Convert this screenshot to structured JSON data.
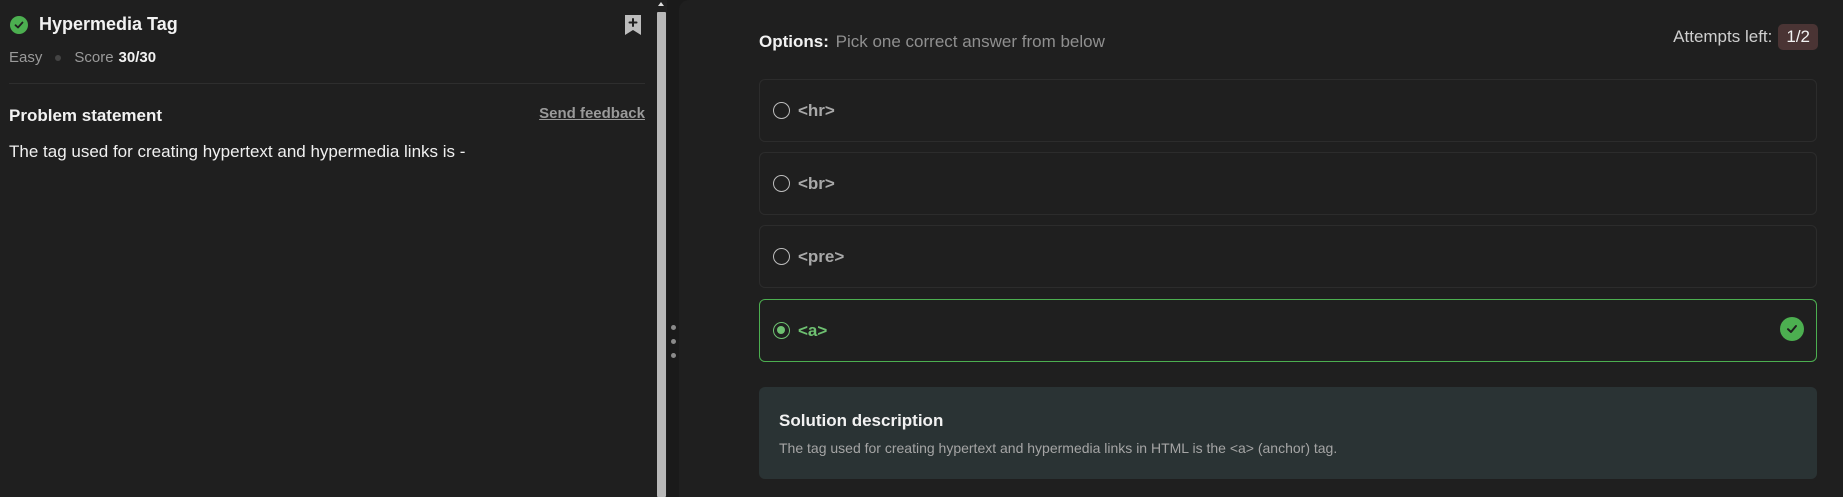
{
  "problem": {
    "title": "Hypermedia Tag",
    "difficulty": "Easy",
    "score_label": "Score",
    "score_value": "30/30",
    "statement_heading": "Problem statement",
    "feedback_link": "Send feedback",
    "statement": "The tag used for creating hypertext and hypermedia links is -"
  },
  "options_panel": {
    "label": "Options:",
    "instruction": "Pick one correct answer from below",
    "attempts_label": "Attempts left:",
    "attempts_value": "1/2",
    "options": [
      {
        "label": "<hr>",
        "selected": false,
        "correct": false
      },
      {
        "label": "<br>",
        "selected": false,
        "correct": false
      },
      {
        "label": "<pre>",
        "selected": false,
        "correct": false
      },
      {
        "label": "<a>",
        "selected": true,
        "correct": true
      }
    ]
  },
  "solution": {
    "title": "Solution description",
    "text": "The tag used for creating hypertext and hypermedia links in HTML is the <a> (anchor) tag."
  },
  "icons": {
    "status": "check-circle-icon",
    "bookmark": "bookmark-add-icon",
    "correct": "check-circle-icon"
  },
  "colors": {
    "success": "#4caf50",
    "background": "#1f1f1f",
    "solution_bg": "#2a3334",
    "attempts_badge": "#4a3434"
  }
}
